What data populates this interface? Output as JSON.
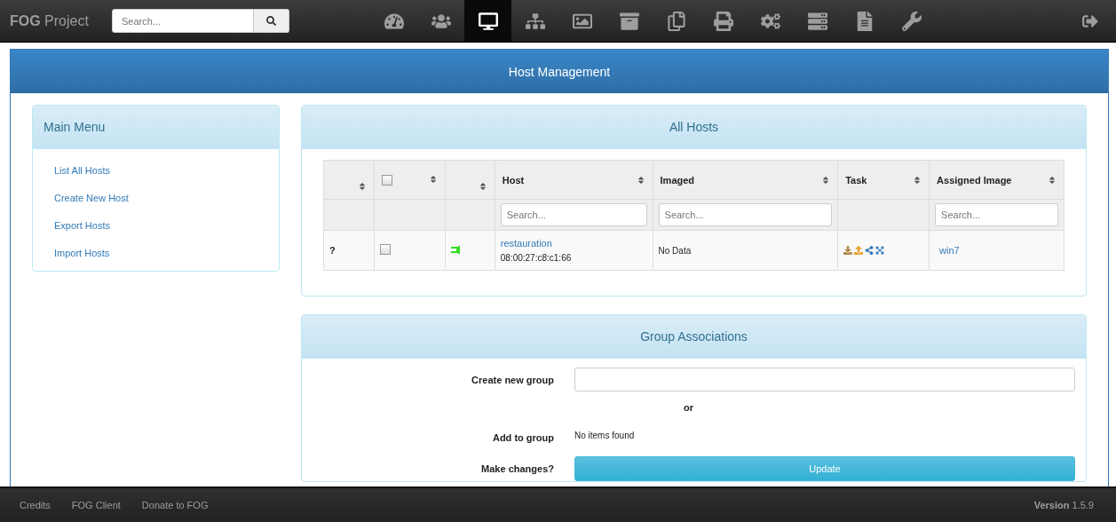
{
  "brand": "**FOG** Project",
  "search": {
    "placeholder": "Search..."
  },
  "nav": [
    {
      "kind": "dashboard",
      "selected": false
    },
    {
      "kind": "users",
      "selected": false
    },
    {
      "kind": "hosts",
      "selected": true
    },
    {
      "kind": "groups",
      "selected": false
    },
    {
      "kind": "images",
      "selected": false
    },
    {
      "kind": "storage",
      "selected": false
    },
    {
      "kind": "snapins",
      "selected": false
    },
    {
      "kind": "printers",
      "selected": false
    },
    {
      "kind": "services",
      "selected": false
    },
    {
      "kind": "tasks",
      "selected": false
    },
    {
      "kind": "reports",
      "selected": false
    },
    {
      "kind": "settings",
      "selected": false
    }
  ],
  "page_title": "Host Management",
  "main_menu": {
    "title": "Main Menu",
    "items": [
      "List All Hosts",
      "Create New Host",
      "Export Hosts",
      "Import Hosts"
    ]
  },
  "all_hosts": {
    "title": "All Hosts",
    "columns": [
      {
        "kind": "blank"
      },
      {
        "kind": "checkbox",
        "checked": false
      },
      {
        "kind": "blank"
      },
      {
        "kind": "text",
        "label": "Host",
        "placeholder": "Search..."
      },
      {
        "kind": "text",
        "label": "Imaged",
        "placeholder": "Search..."
      },
      {
        "kind": "label",
        "label": "Task"
      },
      {
        "kind": "text",
        "label": "Assigned Image",
        "placeholder": "Search..."
      }
    ],
    "rows": [
      {
        "status": "?",
        "checked": false,
        "host": "restauration",
        "mac": "08:00:27:c8:c1:66",
        "imaged": "No Data",
        "assigned_image": "win7"
      }
    ]
  },
  "group_associations": {
    "title": "Group Associations",
    "create_label": "Create new group",
    "or": "or",
    "add_label": "Add to group",
    "add_value": "No items found",
    "changes_label": "Make changes?",
    "button": "Update"
  },
  "footer": {
    "links": [
      "Credits",
      "FOG Client",
      "Donate to FOG"
    ],
    "version": "**Version** 1.5.9"
  }
}
